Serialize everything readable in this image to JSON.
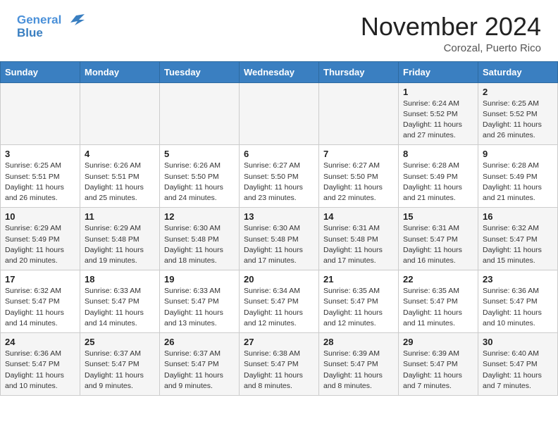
{
  "header": {
    "logo_line1": "General",
    "logo_line2": "Blue",
    "month": "November 2024",
    "location": "Corozal, Puerto Rico"
  },
  "weekdays": [
    "Sunday",
    "Monday",
    "Tuesday",
    "Wednesday",
    "Thursday",
    "Friday",
    "Saturday"
  ],
  "weeks": [
    [
      {
        "day": "",
        "info": ""
      },
      {
        "day": "",
        "info": ""
      },
      {
        "day": "",
        "info": ""
      },
      {
        "day": "",
        "info": ""
      },
      {
        "day": "",
        "info": ""
      },
      {
        "day": "1",
        "info": "Sunrise: 6:24 AM\nSunset: 5:52 PM\nDaylight: 11 hours\nand 27 minutes."
      },
      {
        "day": "2",
        "info": "Sunrise: 6:25 AM\nSunset: 5:52 PM\nDaylight: 11 hours\nand 26 minutes."
      }
    ],
    [
      {
        "day": "3",
        "info": "Sunrise: 6:25 AM\nSunset: 5:51 PM\nDaylight: 11 hours\nand 26 minutes."
      },
      {
        "day": "4",
        "info": "Sunrise: 6:26 AM\nSunset: 5:51 PM\nDaylight: 11 hours\nand 25 minutes."
      },
      {
        "day": "5",
        "info": "Sunrise: 6:26 AM\nSunset: 5:50 PM\nDaylight: 11 hours\nand 24 minutes."
      },
      {
        "day": "6",
        "info": "Sunrise: 6:27 AM\nSunset: 5:50 PM\nDaylight: 11 hours\nand 23 minutes."
      },
      {
        "day": "7",
        "info": "Sunrise: 6:27 AM\nSunset: 5:50 PM\nDaylight: 11 hours\nand 22 minutes."
      },
      {
        "day": "8",
        "info": "Sunrise: 6:28 AM\nSunset: 5:49 PM\nDaylight: 11 hours\nand 21 minutes."
      },
      {
        "day": "9",
        "info": "Sunrise: 6:28 AM\nSunset: 5:49 PM\nDaylight: 11 hours\nand 21 minutes."
      }
    ],
    [
      {
        "day": "10",
        "info": "Sunrise: 6:29 AM\nSunset: 5:49 PM\nDaylight: 11 hours\nand 20 minutes."
      },
      {
        "day": "11",
        "info": "Sunrise: 6:29 AM\nSunset: 5:48 PM\nDaylight: 11 hours\nand 19 minutes."
      },
      {
        "day": "12",
        "info": "Sunrise: 6:30 AM\nSunset: 5:48 PM\nDaylight: 11 hours\nand 18 minutes."
      },
      {
        "day": "13",
        "info": "Sunrise: 6:30 AM\nSunset: 5:48 PM\nDaylight: 11 hours\nand 17 minutes."
      },
      {
        "day": "14",
        "info": "Sunrise: 6:31 AM\nSunset: 5:48 PM\nDaylight: 11 hours\nand 17 minutes."
      },
      {
        "day": "15",
        "info": "Sunrise: 6:31 AM\nSunset: 5:47 PM\nDaylight: 11 hours\nand 16 minutes."
      },
      {
        "day": "16",
        "info": "Sunrise: 6:32 AM\nSunset: 5:47 PM\nDaylight: 11 hours\nand 15 minutes."
      }
    ],
    [
      {
        "day": "17",
        "info": "Sunrise: 6:32 AM\nSunset: 5:47 PM\nDaylight: 11 hours\nand 14 minutes."
      },
      {
        "day": "18",
        "info": "Sunrise: 6:33 AM\nSunset: 5:47 PM\nDaylight: 11 hours\nand 14 minutes."
      },
      {
        "day": "19",
        "info": "Sunrise: 6:33 AM\nSunset: 5:47 PM\nDaylight: 11 hours\nand 13 minutes."
      },
      {
        "day": "20",
        "info": "Sunrise: 6:34 AM\nSunset: 5:47 PM\nDaylight: 11 hours\nand 12 minutes."
      },
      {
        "day": "21",
        "info": "Sunrise: 6:35 AM\nSunset: 5:47 PM\nDaylight: 11 hours\nand 12 minutes."
      },
      {
        "day": "22",
        "info": "Sunrise: 6:35 AM\nSunset: 5:47 PM\nDaylight: 11 hours\nand 11 minutes."
      },
      {
        "day": "23",
        "info": "Sunrise: 6:36 AM\nSunset: 5:47 PM\nDaylight: 11 hours\nand 10 minutes."
      }
    ],
    [
      {
        "day": "24",
        "info": "Sunrise: 6:36 AM\nSunset: 5:47 PM\nDaylight: 11 hours\nand 10 minutes."
      },
      {
        "day": "25",
        "info": "Sunrise: 6:37 AM\nSunset: 5:47 PM\nDaylight: 11 hours\nand 9 minutes."
      },
      {
        "day": "26",
        "info": "Sunrise: 6:37 AM\nSunset: 5:47 PM\nDaylight: 11 hours\nand 9 minutes."
      },
      {
        "day": "27",
        "info": "Sunrise: 6:38 AM\nSunset: 5:47 PM\nDaylight: 11 hours\nand 8 minutes."
      },
      {
        "day": "28",
        "info": "Sunrise: 6:39 AM\nSunset: 5:47 PM\nDaylight: 11 hours\nand 8 minutes."
      },
      {
        "day": "29",
        "info": "Sunrise: 6:39 AM\nSunset: 5:47 PM\nDaylight: 11 hours\nand 7 minutes."
      },
      {
        "day": "30",
        "info": "Sunrise: 6:40 AM\nSunset: 5:47 PM\nDaylight: 11 hours\nand 7 minutes."
      }
    ]
  ]
}
